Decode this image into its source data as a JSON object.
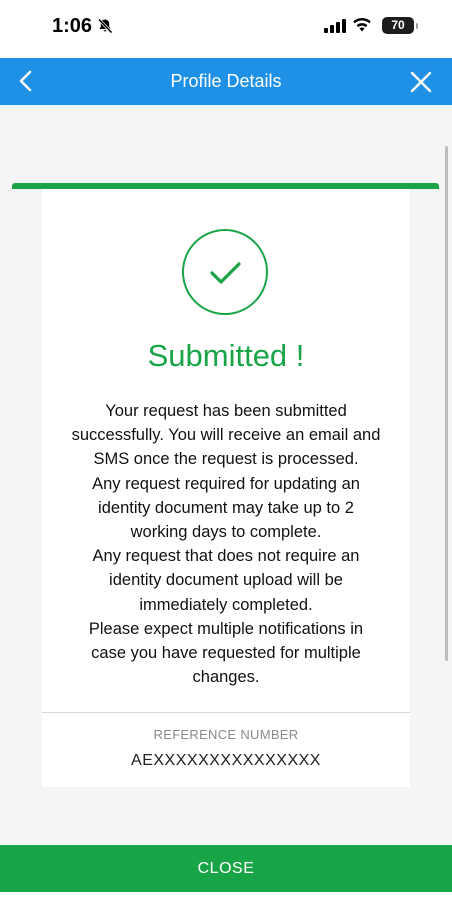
{
  "status_bar": {
    "time": "1:06",
    "battery": "70",
    "icons": [
      "bell-slash-icon",
      "signal-icon",
      "wifi-icon",
      "battery-icon"
    ]
  },
  "header": {
    "title": "Profile Details",
    "back_icon": "chevron-left-icon",
    "close_icon": "close-icon",
    "color": "#1e90e6"
  },
  "result": {
    "icon": "check-icon",
    "title": "Submitted !",
    "color": "#19a447",
    "message_lines": [
      "Your request has been submitted",
      "successfully. You will receive an email and",
      "SMS once the request is processed.",
      "Any request required for updating an",
      "identity document may take up to 2",
      "working days to complete.",
      "Any request that does not require an",
      "identity document upload will be",
      "immediately completed.",
      "Please expect multiple notifications in",
      "case you have requested for multiple",
      "changes."
    ]
  },
  "reference": {
    "label": "REFERENCE NUMBER",
    "value": "AEXXXXXXXXXXXXXXX"
  },
  "footer": {
    "close_label": "CLOSE",
    "color": "#19a447"
  }
}
